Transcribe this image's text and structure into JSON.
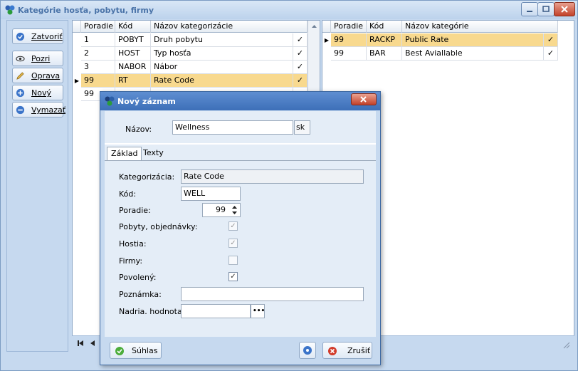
{
  "window": {
    "title": "Kategórie hosťa, pobytu, firmy"
  },
  "left_buttons": [
    {
      "label": "Zatvoriť",
      "icon": "check-circle-icon"
    },
    {
      "label": "Pozri",
      "icon": "eye-icon"
    },
    {
      "label": "Oprava",
      "icon": "pencil-icon"
    },
    {
      "label": "Nový",
      "icon": "plus-circle-icon"
    },
    {
      "label": "Vymazať",
      "icon": "minus-circle-icon"
    }
  ],
  "grid1": {
    "headers": [
      "Poradie",
      "Kód",
      "Názov kategorizácie"
    ],
    "rows": [
      {
        "poradie": "1",
        "kod": "POBYT",
        "nazov": "Druh pobytu",
        "check": "✓"
      },
      {
        "poradie": "2",
        "kod": "HOST",
        "nazov": "Typ hosťa",
        "check": "✓"
      },
      {
        "poradie": "3",
        "kod": "NABOR",
        "nazov": "Nábor",
        "check": "✓"
      },
      {
        "poradie": "99",
        "kod": "RT",
        "nazov": "Rate Code",
        "check": "✓"
      },
      {
        "poradie": "99",
        "kod": "",
        "nazov": "",
        "check": ""
      }
    ]
  },
  "grid2": {
    "headers": [
      "Poradie",
      "Kód",
      "Názov kategórie"
    ],
    "rows": [
      {
        "poradie": "99",
        "kod": "RACKP",
        "nazov": "Public Rate",
        "check": "✓"
      },
      {
        "poradie": "99",
        "kod": "BAR",
        "nazov": "Best Aviallable",
        "check": "✓"
      }
    ]
  },
  "dialog": {
    "title": "Nový záznam",
    "nazov_label": "Názov:",
    "nazov_value": "Wellness",
    "lang_button": "sk",
    "tabs": [
      "Základ",
      "Texty"
    ],
    "fields": {
      "kategorizacia_label": "Kategorizácia:",
      "kategorizacia_value": "Rate Code",
      "kod_label": "Kód:",
      "kod_value": "WELL",
      "poradie_label": "Poradie:",
      "poradie_value": "99",
      "pobyty_label": "Pobyty, objednávky:",
      "hostia_label": "Hostia:",
      "firmy_label": "Firmy:",
      "povoleny_label": "Povolený:",
      "poznamka_label": "Poznámka:",
      "poznamka_value": "",
      "nadria_label": "Nadria. hodnota:",
      "nadria_value": "",
      "ellipsis": "•••"
    },
    "buttons": {
      "ok": "Súhlas",
      "cancel": "Zrušiť"
    }
  }
}
